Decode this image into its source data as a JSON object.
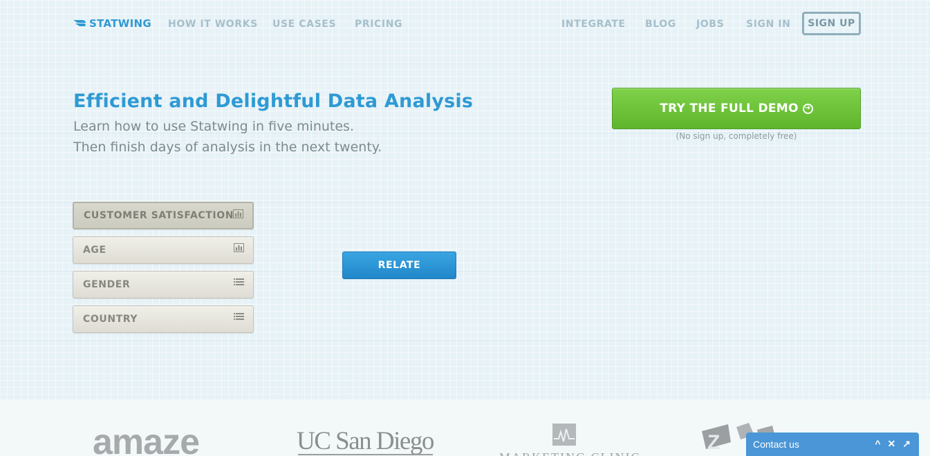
{
  "nav": {
    "logo_text": "STATWING",
    "left_items": [
      "HOW IT WORKS",
      "USE CASES",
      "PRICING"
    ],
    "right_items": [
      "INTEGRATE",
      "BLOG",
      "JOBS",
      "SIGN IN"
    ],
    "signup_label": "SIGN UP"
  },
  "hero": {
    "headline": "Efficient and Delightful Data Analysis",
    "subline_1": "Learn how to use Statwing in five minutes.",
    "subline_2": "Then finish days of analysis in the next twenty.",
    "demo_button": "TRY THE FULL DEMO",
    "demo_note": "(No sign up, completely free)"
  },
  "variables": [
    {
      "label": "CUSTOMER SATISFACTION",
      "icon": "bar-chart-icon",
      "selected": true
    },
    {
      "label": "AGE",
      "icon": "bar-chart-icon",
      "selected": false
    },
    {
      "label": "GENDER",
      "icon": "list-icon",
      "selected": false
    },
    {
      "label": "COUNTRY",
      "icon": "list-icon",
      "selected": false
    }
  ],
  "relate_button": "RELATE",
  "customer_logos": {
    "amaze": "amaze",
    "ucsd": "UC San Diego",
    "marketing_clinic": "MARKETING CLINIC"
  },
  "chat": {
    "label": "Contact us",
    "minimize": "^",
    "close": "✕",
    "popout": "↗"
  },
  "colors": {
    "brand_blue": "#2e9ad4",
    "demo_green": "#6cc23a",
    "relate_blue": "#2a95d6",
    "nav_text": "#a6bfcb"
  }
}
